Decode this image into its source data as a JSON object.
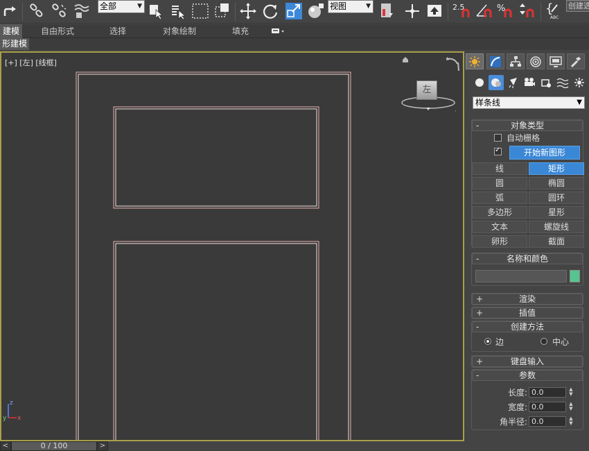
{
  "toolbar": {
    "selection_filter": "全部",
    "ref_coord": "视图",
    "snap_value": "2.5",
    "create_selection_set": "创建选",
    "icons": [
      "redo-icon",
      "link-icon",
      "unlink-icon",
      "bind-spacewarp-icon",
      "select-object-icon",
      "select-by-name-icon",
      "rect-region-icon",
      "window-crossing-icon",
      "move-icon",
      "rotate-icon",
      "scale-icon",
      "sphere-icon",
      "mirror-icon",
      "align-icon",
      "snap-icon",
      "angle-snap-icon",
      "percent-snap-icon",
      "spinner-snap-icon",
      "edit-named-sel-icon"
    ]
  },
  "ribbon": {
    "tabs": [
      "建模",
      "自由形式",
      "选择",
      "对象绘制",
      "填充"
    ],
    "active_tab": "建模",
    "sub_label": "形建模"
  },
  "viewport": {
    "label": "[+] [左] [线框]",
    "cube_face": "左",
    "axis_z": "z",
    "axis_y": "y",
    "axis_x": "x",
    "shape_color": "#e8b0b0"
  },
  "timeline": {
    "prev": "<",
    "frame": "0 / 100",
    "next": ">"
  },
  "panel": {
    "category": "样条线",
    "object_type": {
      "title": "对象类型",
      "sign": "-",
      "autogrid": "自动栅格",
      "autogrid_checked": false,
      "start_new_shape": "开始新图形",
      "start_new_shape_checked": true,
      "buttons": [
        "线",
        "矩形",
        "圆",
        "椭圆",
        "弧",
        "圆环",
        "多边形",
        "星形",
        "文本",
        "螺旋线",
        "卵形",
        "截面"
      ],
      "active_button": "矩形"
    },
    "name_color": {
      "title": "名称和颜色",
      "sign": "-",
      "name_value": "",
      "swatch_color": "#56c48e"
    },
    "rendering": {
      "title": "渲染",
      "sign": "+"
    },
    "interpolation": {
      "title": "插值",
      "sign": "+"
    },
    "creation_method": {
      "title": "创建方法",
      "sign": "-",
      "edge": "边",
      "center": "中心",
      "selected": "边"
    },
    "keyboard": {
      "title": "键盘输入",
      "sign": "+"
    },
    "parameters": {
      "title": "参数",
      "sign": "-",
      "length_label": "长度:",
      "length": "0.0",
      "width_label": "宽度:",
      "width": "0.0",
      "corner_label": "角半径:",
      "corner": "0.0"
    }
  }
}
